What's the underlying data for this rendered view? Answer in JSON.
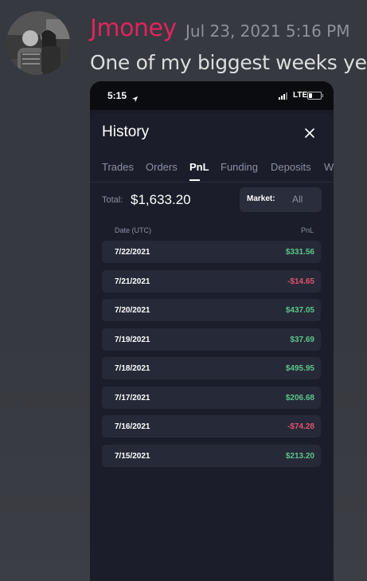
{
  "message": {
    "username": "Jmoney",
    "timestamp": "Jul 23, 2021 5:16 PM",
    "text": "One of my biggest weeks yet",
    "username_color": "#e0245e"
  },
  "phone": {
    "status_bar": {
      "time": "5:15",
      "network": "LTE",
      "location_icon": "location-arrow-icon",
      "battery_icon": "battery-icon"
    },
    "sheet": {
      "title": "History",
      "close_icon": "close-icon",
      "tabs": [
        {
          "label": "Trades",
          "active": false
        },
        {
          "label": "Orders",
          "active": false
        },
        {
          "label": "PnL",
          "active": true
        },
        {
          "label": "Funding",
          "active": false
        },
        {
          "label": "Deposits",
          "active": false
        },
        {
          "label": "W",
          "active": false
        }
      ],
      "total_label": "Total:",
      "total_value": "$1,633.20",
      "market_label": "Market:",
      "market_value": "All",
      "columns": {
        "date": "Date (UTC)",
        "pnl": "PnL"
      },
      "rows": [
        {
          "date": "7/22/2021",
          "pnl": "$331.56",
          "positive": true
        },
        {
          "date": "7/21/2021",
          "pnl": "-$14.65",
          "positive": false
        },
        {
          "date": "7/20/2021",
          "pnl": "$437.05",
          "positive": true
        },
        {
          "date": "7/19/2021",
          "pnl": "$37.69",
          "positive": true
        },
        {
          "date": "7/18/2021",
          "pnl": "$495.95",
          "positive": true
        },
        {
          "date": "7/17/2021",
          "pnl": "$206.68",
          "positive": true
        },
        {
          "date": "7/16/2021",
          "pnl": "-$74.28",
          "positive": false
        },
        {
          "date": "7/15/2021",
          "pnl": "$213.20",
          "positive": true
        }
      ],
      "colors": {
        "positive": "#5dc48a",
        "negative": "#e2516e"
      }
    }
  }
}
